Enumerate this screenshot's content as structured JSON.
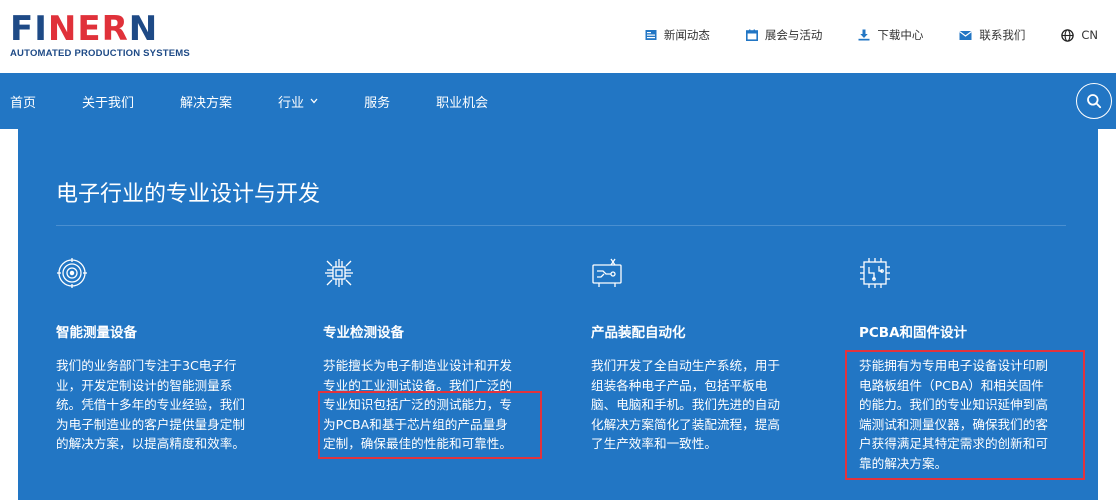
{
  "brand": {
    "logo_pre": "FI",
    "logo_mid": "NER",
    "logo_end": "N",
    "tagline": "AUTOMATED PRODUCTION SYSTEMS",
    "accent": "#1e4a86",
    "red": "#e0313a",
    "nav_bg": "#2276c4"
  },
  "toplinks": {
    "news": "新闻动态",
    "events": "展会与活动",
    "downloads": "下载中心",
    "contact": "联系我们",
    "lang": "CN"
  },
  "nav": {
    "home": "首页",
    "about": "关于我们",
    "solutions": "解决方案",
    "industry": "行业",
    "service": "服务",
    "careers": "职业机会"
  },
  "main": {
    "title": "电子行业的专业设计与开发",
    "cols": [
      {
        "icon": "target-icon",
        "title": "智能测量设备",
        "lines": [
          "我们的业务部门专注于3C电子行",
          "业，开发定制设计的智能测量系",
          "统。凭借十多年的专业经验，我们",
          "为电子制造业的客户提供量身定制",
          "的解决方案，以提高精度和效率。"
        ]
      },
      {
        "icon": "chip-icon",
        "title": "专业检测设备",
        "lines": [
          "芬能擅长为电子制造业设计和开发",
          "专业的工业测试设备。我们广泛的",
          "专业知识包括广泛的测试能力，专",
          "为PCBA和基于芯片组的产品量身",
          "定制，确保最佳的性能和可靠性。"
        ]
      },
      {
        "icon": "assembly-icon",
        "title": "产品装配自动化",
        "lines": [
          "我们开发了全自动生产系统，用于",
          "组装各种电子产品，包括平板电",
          "脑、电脑和手机。我们先进的自动",
          "化解决方案简化了装配流程，提高",
          "了生产效率和一致性。"
        ]
      },
      {
        "icon": "pcb-icon",
        "title": "PCBA和固件设计",
        "lines": [
          "芬能拥有为专用电子设备设计印刷",
          "电路板组件（PCBA）和相关固件",
          "的能力。我们的专业知识延伸到高",
          "端测试和测量仪器，确保我们的客",
          "户获得满足其特定需求的创新和可",
          "靠的解决方案。"
        ]
      }
    ]
  }
}
